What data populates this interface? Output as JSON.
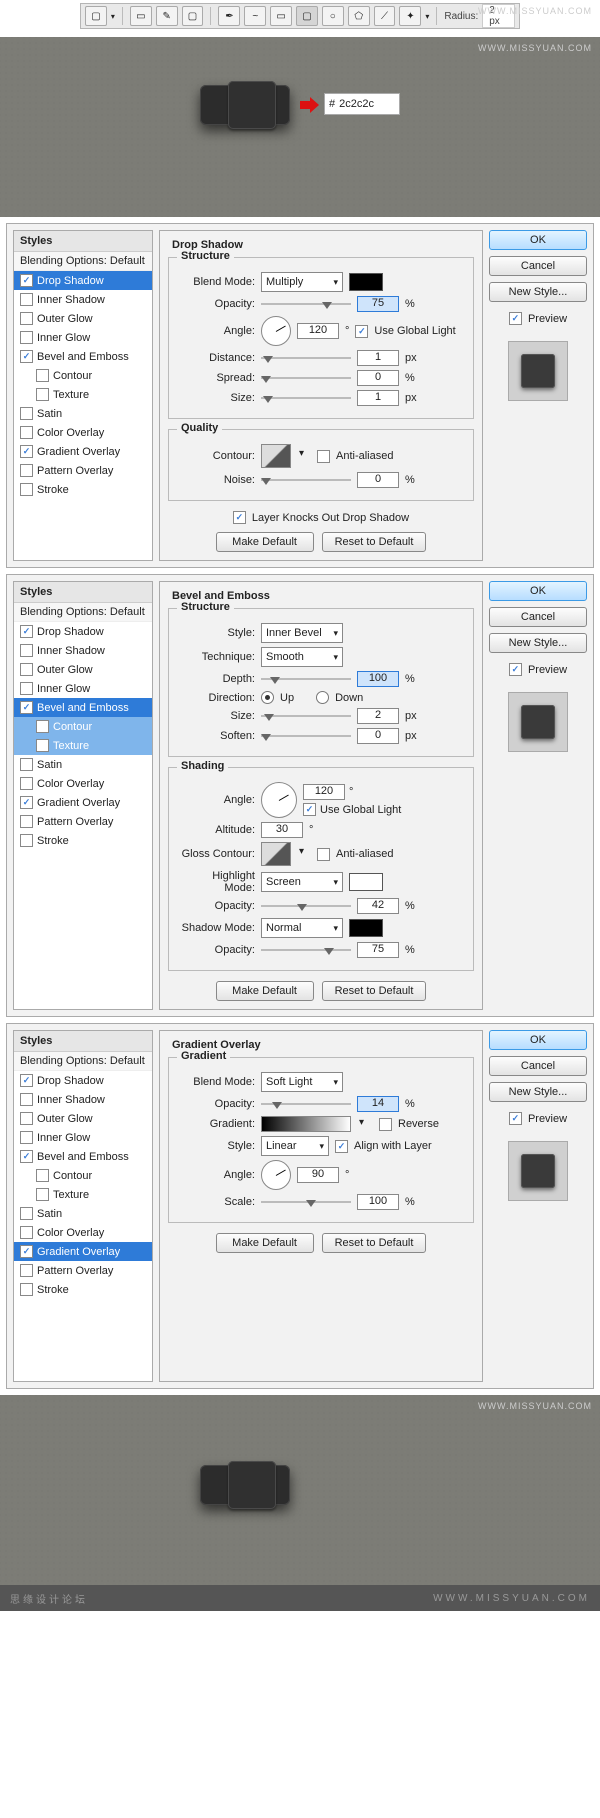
{
  "watermark": "WWW.MISSYUAN.COM",
  "toolbar": {
    "radius_label": "Radius:",
    "radius_value": "2 px"
  },
  "hex": {
    "hash": "#",
    "value": "2c2c2c"
  },
  "styles": {
    "header": "Styles",
    "blending": "Blending Options: Default",
    "items": [
      "Drop Shadow",
      "Inner Shadow",
      "Outer Glow",
      "Inner Glow",
      "Bevel and Emboss",
      "Contour",
      "Texture",
      "Satin",
      "Color Overlay",
      "Gradient Overlay",
      "Pattern Overlay",
      "Stroke"
    ]
  },
  "buttons": {
    "ok": "OK",
    "cancel": "Cancel",
    "newstyle": "New Style...",
    "preview": "Preview",
    "make_default": "Make Default",
    "reset_default": "Reset to Default"
  },
  "p1": {
    "title": "Drop Shadow",
    "structure": "Structure",
    "quality": "Quality",
    "blend_label": "Blend Mode:",
    "blend_value": "Multiply",
    "opacity_label": "Opacity:",
    "opacity_value": "75",
    "pct": "%",
    "angle_label": "Angle:",
    "angle_value": "120",
    "deg": "°",
    "global": "Use Global Light",
    "distance_label": "Distance:",
    "distance_value": "1",
    "px": "px",
    "spread_label": "Spread:",
    "spread_value": "0",
    "size_label": "Size:",
    "size_value": "1",
    "contour_label": "Contour:",
    "anti": "Anti-aliased",
    "noise_label": "Noise:",
    "noise_value": "0",
    "knock": "Layer Knocks Out Drop Shadow"
  },
  "p2": {
    "title": "Bevel and Emboss",
    "structure": "Structure",
    "shading": "Shading",
    "style_label": "Style:",
    "style_value": "Inner Bevel",
    "tech_label": "Technique:",
    "tech_value": "Smooth",
    "depth_label": "Depth:",
    "depth_value": "100",
    "dir_label": "Direction:",
    "up": "Up",
    "down": "Down",
    "size_label": "Size:",
    "size_value": "2",
    "soften_label": "Soften:",
    "soften_value": "0",
    "angle_label": "Angle:",
    "angle_value": "120",
    "global": "Use Global Light",
    "alt_label": "Altitude:",
    "alt_value": "30",
    "gloss_label": "Gloss Contour:",
    "anti": "Anti-aliased",
    "hi_label": "Highlight Mode:",
    "hi_value": "Screen",
    "hi_op": "42",
    "sh_label": "Shadow Mode:",
    "sh_value": "Normal",
    "sh_op": "75",
    "opacity_label": "Opacity:",
    "pct": "%",
    "px": "px",
    "deg": "°"
  },
  "p3": {
    "title": "Gradient Overlay",
    "gradient": "Gradient",
    "blend_label": "Blend Mode:",
    "blend_value": "Soft Light",
    "opacity_label": "Opacity:",
    "opacity_value": "14",
    "grad_label": "Gradient:",
    "reverse": "Reverse",
    "style_label": "Style:",
    "style_value": "Linear",
    "align": "Align with Layer",
    "angle_label": "Angle:",
    "angle_value": "90",
    "scale_label": "Scale:",
    "scale_value": "100",
    "pct": "%",
    "deg": "°"
  },
  "footer": "思缘设计论坛"
}
